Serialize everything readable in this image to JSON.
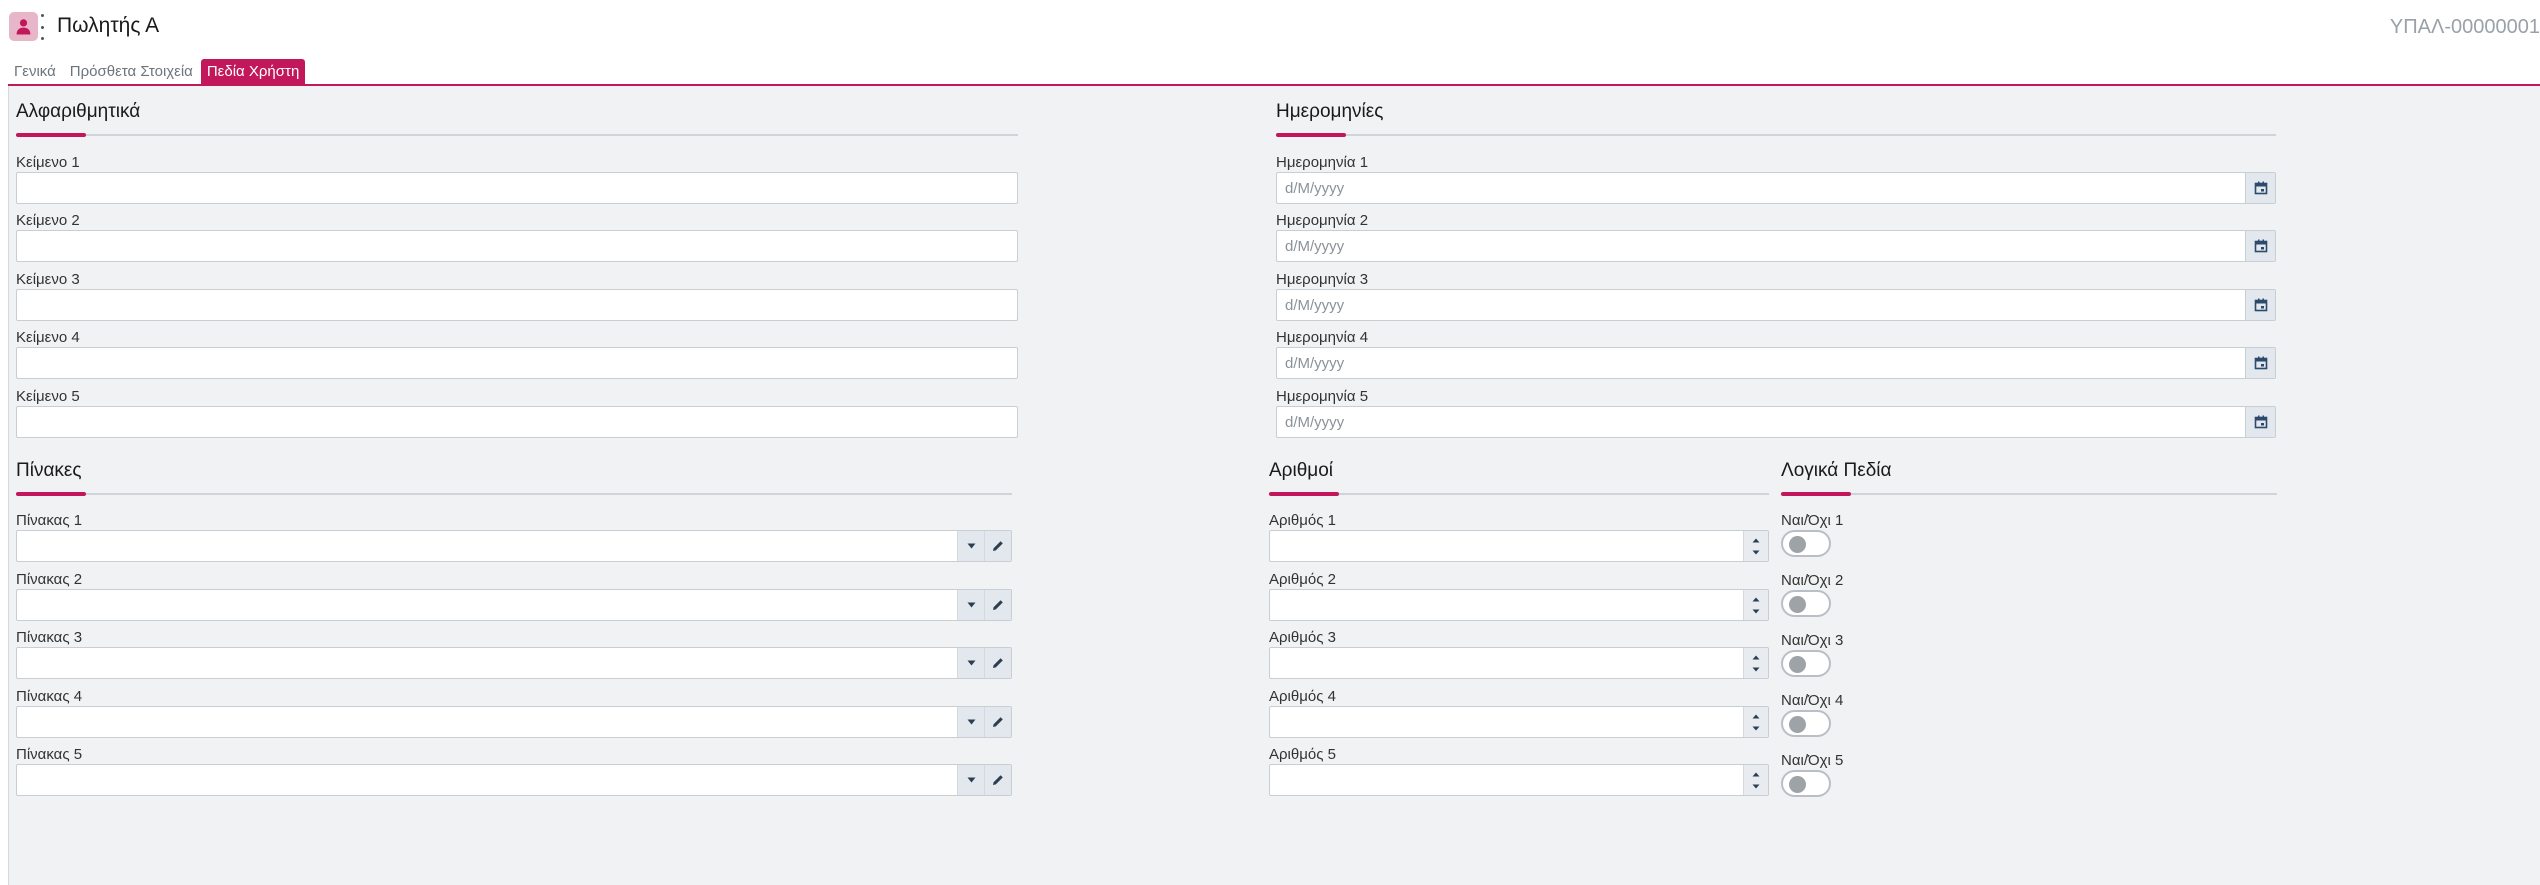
{
  "header": {
    "title": "Πωλητής Α",
    "code": "ΥΠΑΛ-00000001"
  },
  "tabs": [
    {
      "label": "Γενικά",
      "active": false
    },
    {
      "label": "Πρόσθετα Στοιχεία",
      "active": false
    },
    {
      "label": "Πεδία Χρήστη",
      "active": true
    }
  ],
  "sections": {
    "text": {
      "title": "Αλφαριθμητικά",
      "fields": [
        {
          "label": "Κείμενο 1",
          "value": ""
        },
        {
          "label": "Κείμενο 2",
          "value": ""
        },
        {
          "label": "Κείμενο 3",
          "value": ""
        },
        {
          "label": "Κείμενο 4",
          "value": ""
        },
        {
          "label": "Κείμενο 5",
          "value": ""
        }
      ]
    },
    "dates": {
      "title": "Ημερομηνίες",
      "fields": [
        {
          "label": "Ημερομηνία 1",
          "placeholder": "d/M/yyyy"
        },
        {
          "label": "Ημερομηνία 2",
          "placeholder": "d/M/yyyy"
        },
        {
          "label": "Ημερομηνία 3",
          "placeholder": "d/M/yyyy"
        },
        {
          "label": "Ημερομηνία 4",
          "placeholder": "d/M/yyyy"
        },
        {
          "label": "Ημερομηνία 5",
          "placeholder": "d/M/yyyy"
        }
      ]
    },
    "tables": {
      "title": "Πίνακες",
      "fields": [
        {
          "label": "Πίνακας 1",
          "value": ""
        },
        {
          "label": "Πίνακας 2",
          "value": ""
        },
        {
          "label": "Πίνακας 3",
          "value": ""
        },
        {
          "label": "Πίνακας 4",
          "value": ""
        },
        {
          "label": "Πίνακας 5",
          "value": ""
        }
      ]
    },
    "numbers": {
      "title": "Αριθμοί",
      "fields": [
        {
          "label": "Αριθμός 1",
          "value": ""
        },
        {
          "label": "Αριθμός 2",
          "value": ""
        },
        {
          "label": "Αριθμός 3",
          "value": ""
        },
        {
          "label": "Αριθμός 4",
          "value": ""
        },
        {
          "label": "Αριθμός 5",
          "value": ""
        }
      ]
    },
    "booleans": {
      "title": "Λογικά Πεδία",
      "fields": [
        {
          "label": "Ναι/Όχι 1",
          "checked": false
        },
        {
          "label": "Ναι/Όχι 2",
          "checked": false
        },
        {
          "label": "Ναι/Όχι 3",
          "checked": false
        },
        {
          "label": "Ναι/Όχι 4",
          "checked": false
        },
        {
          "label": "Ναι/Όχι 5",
          "checked": false
        }
      ]
    }
  },
  "icons": {
    "avatar": "user-icon",
    "menu": "kebab-menu-icon",
    "date_button": "calendar-icon",
    "dropdown": "caret-down-icon",
    "edit": "pencil-icon",
    "spin_up": "caret-up-icon",
    "spin_down": "caret-down-icon"
  },
  "colors": {
    "accent": "#c2185b",
    "avatar_bg": "#e7b6c8",
    "content_bg": "#f0f2f3"
  }
}
